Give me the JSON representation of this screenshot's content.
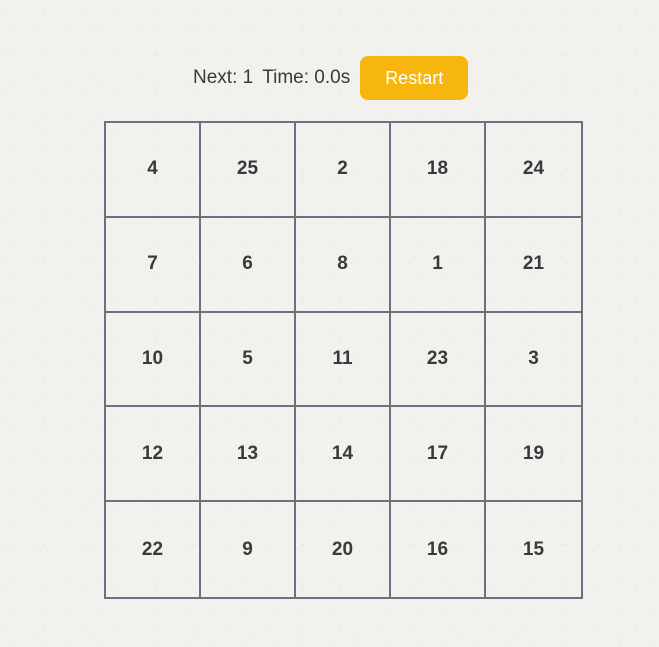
{
  "status": {
    "next_text": "Next: 1",
    "time_text": "Time: 0.0s"
  },
  "controls": {
    "restart_label": "Restart"
  },
  "colors": {
    "background": "#f3f1ee",
    "grid_line": "#6b7082",
    "restart_button": "#f6b60d",
    "text": "#3a3a3a"
  },
  "board": {
    "rows": 5,
    "cols": 5,
    "cells": [
      4,
      25,
      2,
      18,
      24,
      7,
      6,
      8,
      1,
      21,
      10,
      5,
      11,
      23,
      3,
      12,
      13,
      14,
      17,
      19,
      22,
      9,
      20,
      16,
      15
    ]
  }
}
